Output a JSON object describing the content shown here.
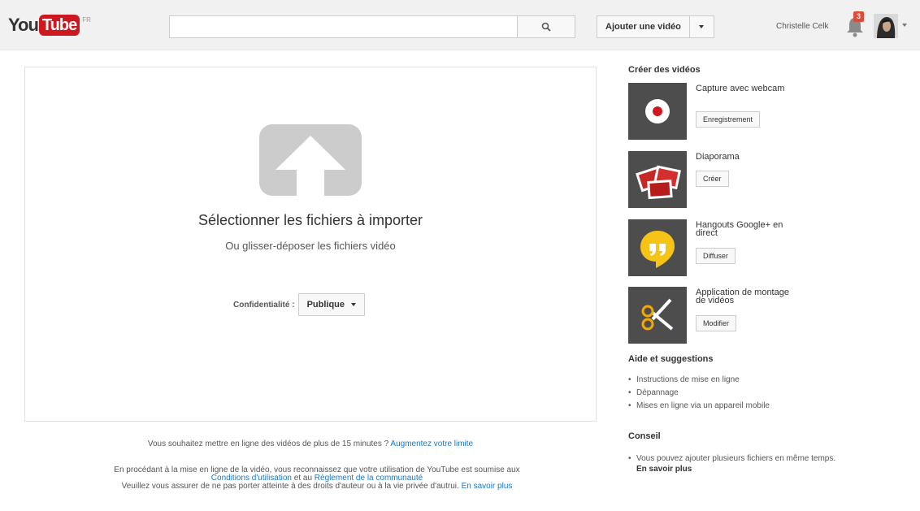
{
  "header": {
    "logo_you": "You",
    "logo_tube": "Tube",
    "logo_region": "FR",
    "search_placeholder": "",
    "upload_label": "Ajouter une vidéo",
    "user_name": "Christelle Celk",
    "notification_count": "3"
  },
  "upload": {
    "title": "Sélectionner les fichiers à importer",
    "subtitle": "Ou glisser-déposer les fichiers vidéo",
    "privacy_label": "Confidentialité :",
    "privacy_value": "Publique",
    "long_video_text": "Vous souhaitez mettre en ligne des vidéos de plus de 15 minutes ?",
    "long_video_link": "Augmentez votre limite",
    "terms_line1": "En procédant à la mise en ligne de la vidéo, vous reconnaissez que votre utilisation de YouTube est soumise aux",
    "terms_link1": "Conditions d'utilisation",
    "terms_and": "et au",
    "terms_link2": "Règlement de la communauté",
    "terms_line3": "Veuillez vous assurer de ne pas porter atteinte à des droits d'auteur ou à la vie privée d'autrui.",
    "terms_link3": "En savoir plus"
  },
  "sidebar": {
    "create_heading": "Créer des vidéos",
    "create_items": [
      {
        "title": "Capture avec webcam",
        "button": "Enregistrement"
      },
      {
        "title": "Diaporama",
        "button": "Créer"
      },
      {
        "title": "Hangouts Google+ en direct",
        "button": "Diffuser"
      },
      {
        "title": "Application de montage de vidéos",
        "button": "Modifier"
      }
    ],
    "help_heading": "Aide et suggestions",
    "help_items": [
      "Instructions de mise en ligne",
      "Dépannage",
      "Mises en ligne via un appareil mobile"
    ],
    "tip_heading": "Conseil",
    "tip_text": "Vous pouvez ajouter plusieurs fichiers en même temps.",
    "tip_link": "En savoir plus"
  },
  "colors": {
    "brand_red": "#cc181e",
    "link_blue": "#1b77c2",
    "header_bg": "#f1f1f1",
    "icon_gray": "#cccccc"
  }
}
